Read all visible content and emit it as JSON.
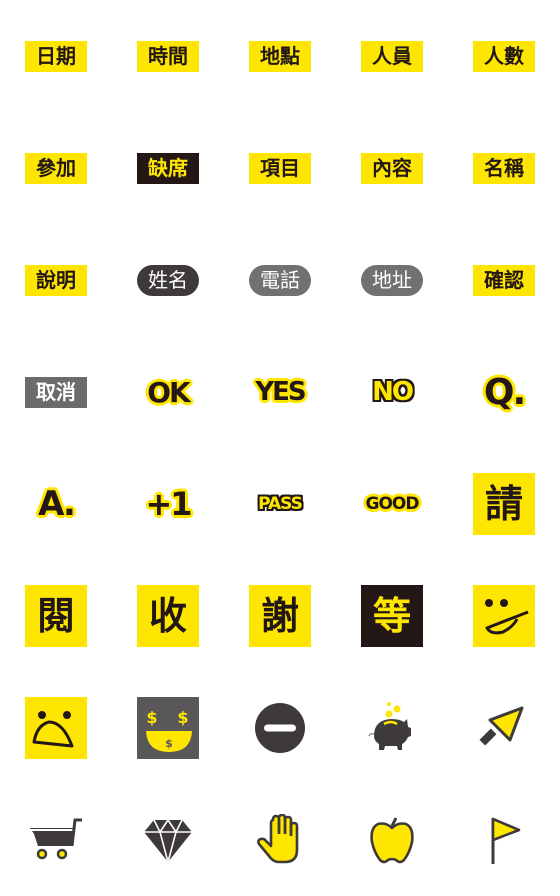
{
  "colors": {
    "yellow": "#ffe600",
    "black": "#231815",
    "dark_gray": "#3e3a39",
    "mid_gray": "#6b6b6b",
    "white": "#ffffff"
  },
  "stickers": {
    "row1": [
      "日期",
      "時間",
      "地點",
      "人員",
      "人數"
    ],
    "row2": [
      "參加",
      "缺席",
      "項目",
      "內容",
      "名稱"
    ],
    "row3": [
      "說明",
      "姓名",
      "電話",
      "地址",
      "確認"
    ],
    "row4": [
      "取消",
      "OK",
      "YES",
      "NO",
      "Q."
    ],
    "row5": [
      "A.",
      "+1",
      "PASS",
      "GOOD",
      "請"
    ],
    "row6": [
      "閱",
      "收",
      "謝",
      "等"
    ]
  },
  "icons": {
    "row6_last": "tongue-smiley-icon",
    "row7": [
      "frown-face-icon",
      "money-eyes-face-icon",
      "no-entry-icon",
      "piggy-bank-icon",
      "cursor-arrow-icon"
    ],
    "row8": [
      "shopping-cart-icon",
      "diamond-icon",
      "raised-hand-icon",
      "apple-icon",
      "flag-icon"
    ]
  }
}
